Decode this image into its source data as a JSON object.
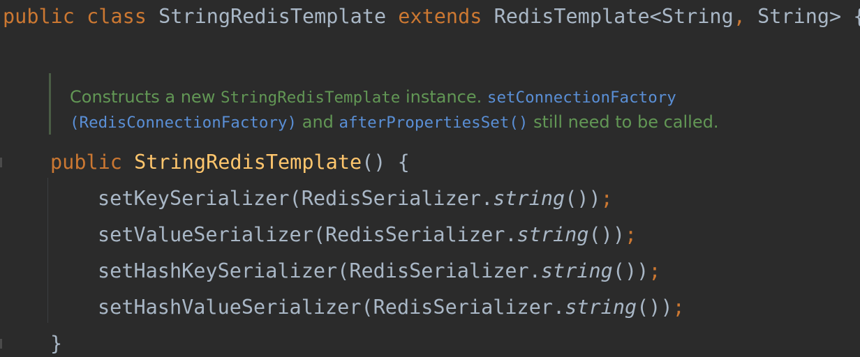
{
  "class_decl": {
    "kw_public": "public",
    "kw_class": "class",
    "class_name": "StringRedisTemplate",
    "kw_extends": "extends",
    "parent": "RedisTemplate<String",
    "comma": ",",
    "generic_rest": " String> {"
  },
  "javadoc": {
    "text1": "Constructs a new ",
    "code_class": "StringRedisTemplate",
    "text2": " instance. ",
    "link1a": "setConnectionFactory",
    "link1b": "(RedisConnectionFactory)",
    "text3": " and ",
    "link2": "afterPropertiesSet()",
    "text4": " still need to be called."
  },
  "ctor": {
    "kw_public": "public",
    "name": "StringRedisTemplate",
    "tail": "() {"
  },
  "calls": [
    {
      "method": "setKeySerializer(RedisSerializer.",
      "italic": "string",
      "close": "())",
      "semi": ";"
    },
    {
      "method": "setValueSerializer(RedisSerializer.",
      "italic": "string",
      "close": "())",
      "semi": ";"
    },
    {
      "method": "setHashKeySerializer(RedisSerializer.",
      "italic": "string",
      "close": "())",
      "semi": ";"
    },
    {
      "method": "setHashValueSerializer(RedisSerializer.",
      "italic": "string",
      "close": "())",
      "semi": ";"
    }
  ],
  "closing_brace": "}",
  "colors": {
    "background": "#2b2b2b",
    "keyword": "#cc7832",
    "identifier": "#a9b7c6",
    "method_declaration": "#ffc66d",
    "javadoc_text": "#629755",
    "javadoc_link": "#5a8fd6"
  }
}
